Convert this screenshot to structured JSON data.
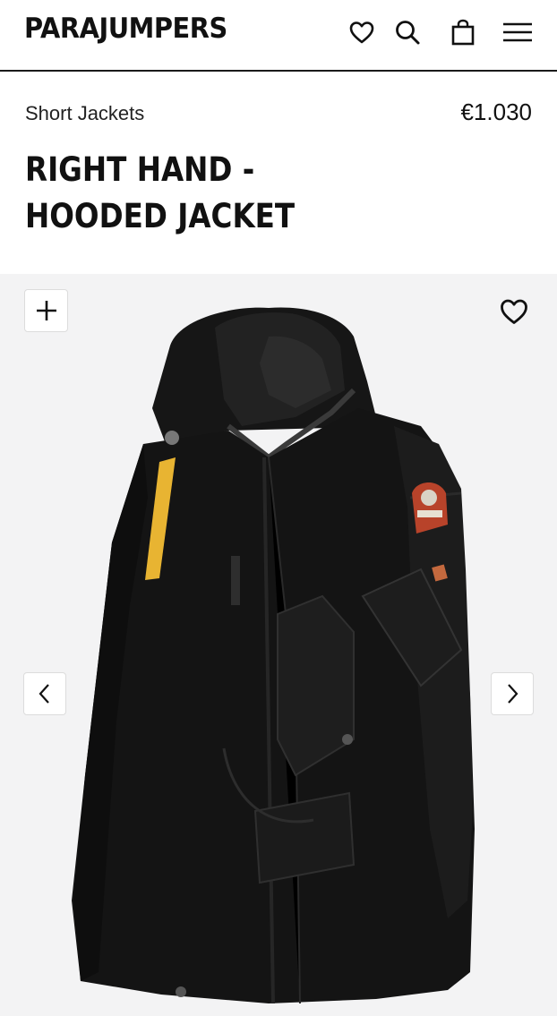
{
  "header": {
    "logo": "PARAJUMPERS",
    "icons": [
      "heart-icon",
      "search-icon",
      "bag-icon",
      "menu-icon"
    ]
  },
  "product": {
    "category": "Short Jackets",
    "price": "€1.030",
    "title": "RIGHT HAND - HOODED JACKET"
  },
  "gallery": {
    "image_alt": "Black hooded jacket with yellow strap and shoulder patch",
    "controls": [
      "plus-icon",
      "heart-icon",
      "chevron-left-icon",
      "chevron-right-icon"
    ]
  },
  "colors": {
    "text": "#111111",
    "gallery_bg": "#f3f3f4",
    "jacket": "#141414",
    "strap": "#e8b432",
    "patch": "#b8432a"
  }
}
